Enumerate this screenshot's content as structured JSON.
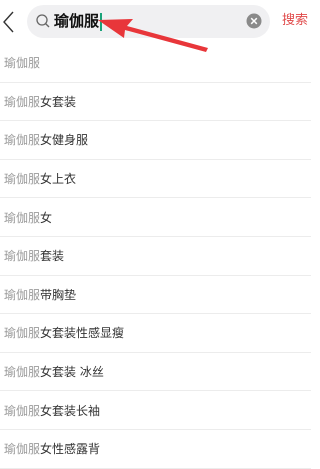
{
  "search": {
    "query": "瑜伽服",
    "submit_label": "搜索"
  },
  "colors": {
    "accent": "#e04a4a",
    "caret": "#1aa37a",
    "annotation_arrow": "#e8363a"
  },
  "icons": {
    "back": "chevron-left-icon",
    "search": "search-icon",
    "clear": "clear-icon"
  },
  "suggestions": [
    {
      "keyword": "瑜伽服",
      "suffix": ""
    },
    {
      "keyword": "瑜伽服",
      "suffix": "女套装"
    },
    {
      "keyword": "瑜伽服",
      "suffix": "女健身服"
    },
    {
      "keyword": "瑜伽服",
      "suffix": "女上衣"
    },
    {
      "keyword": "瑜伽服",
      "suffix": "女"
    },
    {
      "keyword": "瑜伽服",
      "suffix": "套装"
    },
    {
      "keyword": "瑜伽服",
      "suffix": "带胸垫"
    },
    {
      "keyword": "瑜伽服",
      "suffix": "女套装性感显瘦"
    },
    {
      "keyword": "瑜伽服",
      "suffix": "女套装 冰丝"
    },
    {
      "keyword": "瑜伽服",
      "suffix": "女套装长袖"
    },
    {
      "keyword": "瑜伽服",
      "suffix": "女性感露背"
    }
  ]
}
